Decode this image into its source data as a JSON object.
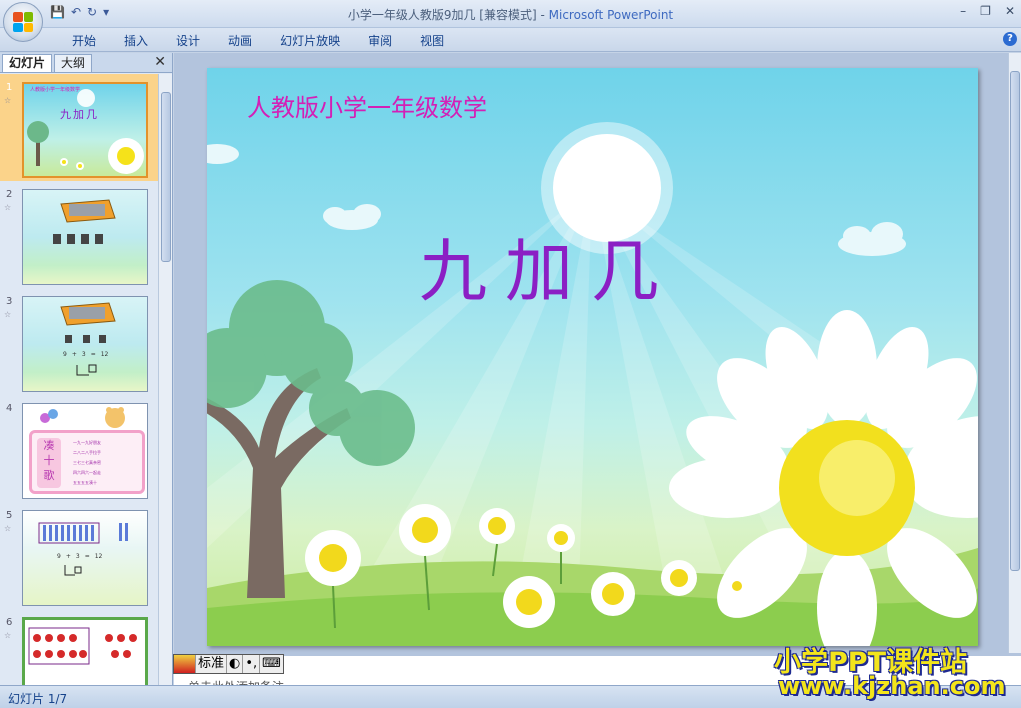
{
  "window": {
    "title": "小学一年级人教版9加几 [兼容模式]",
    "separator": " - ",
    "app_name": "Microsoft PowerPoint",
    "minimize": "–",
    "restore": "❐",
    "close": "✕"
  },
  "quick_access": {
    "save": "💾",
    "undo": "↶",
    "redo": "↻",
    "more": "▾"
  },
  "ribbon": {
    "tabs": [
      "开始",
      "插入",
      "设计",
      "动画",
      "幻灯片放映",
      "审阅",
      "视图"
    ],
    "help": "?"
  },
  "left_pane": {
    "tabs": [
      "幻灯片",
      "大纲"
    ],
    "close": "✕",
    "slides": [
      {
        "num": "1",
        "anim": "☆"
      },
      {
        "num": "2",
        "anim": "☆"
      },
      {
        "num": "3",
        "anim": "☆"
      },
      {
        "num": "4",
        "anim": ""
      },
      {
        "num": "5",
        "anim": "☆"
      },
      {
        "num": "6",
        "anim": "☆"
      }
    ],
    "thumb4": {
      "title": [
        "凑",
        "十",
        "歌"
      ],
      "lines": [
        "一九一九好朋友",
        "二八二八手拉手",
        "三七三七真亲密",
        "四六四六一起走",
        "五五五五凑十"
      ]
    },
    "thumb1": {
      "sub": "人教版小学一年级数学",
      "title": "九加几"
    },
    "thumb_eq": {
      "a": "9",
      "plus": "+",
      "b": "3",
      "eq": "=",
      "c": "12"
    }
  },
  "slide": {
    "subtitle": "人教版小学一年级数学",
    "title": "九加几",
    "colors": {
      "subtitle": "#d41fb6",
      "title": "#8b1fc4"
    }
  },
  "notes": {
    "placeholder": "单击此处添加备注"
  },
  "ime": {
    "mode": "标准",
    "moon": "◐",
    "punct": "•,",
    "kbd": "⌨"
  },
  "status": {
    "slide_counter": "幻灯片 1/7"
  },
  "watermark": {
    "line1": "小学PPT课件站",
    "line2": "www.kjzhan.com"
  }
}
